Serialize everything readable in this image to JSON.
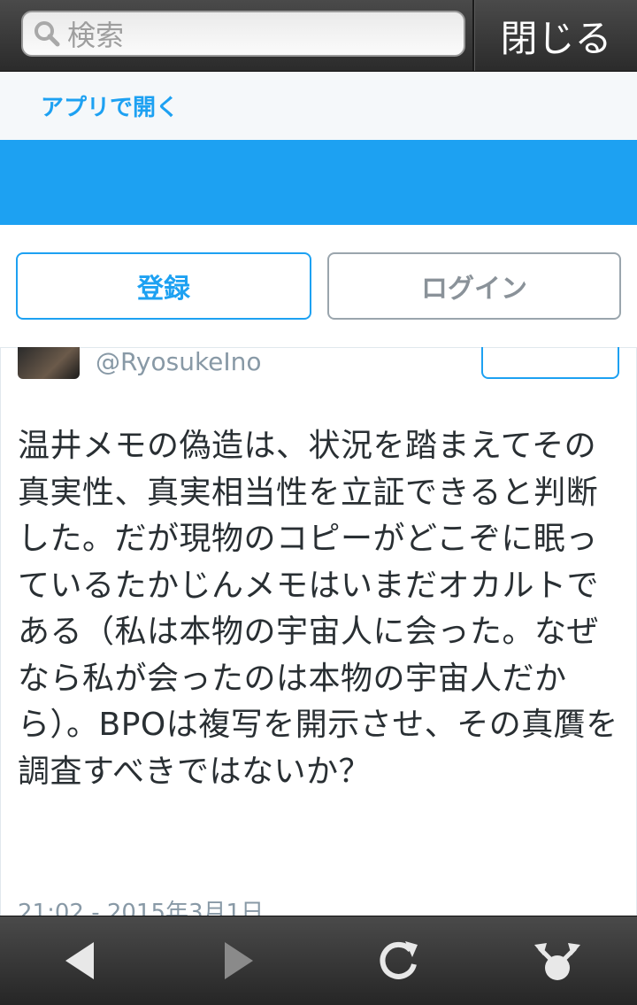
{
  "search": {
    "placeholder": "検索"
  },
  "header": {
    "close_label": "閉じる"
  },
  "open_app": {
    "label": "アプリで開く"
  },
  "auth": {
    "register_label": "登録",
    "login_label": "ログイン"
  },
  "tweet": {
    "handle": "@RyosukeIno",
    "text": "温井メモの偽造は、状況を踏まえてその真実性、真実相当性を立証できると判断した。だが現物のコピーがどこぞに眠っているたかじんメモはいまだオカルトである（私は本物の宇宙人に会った。なぜなら私が会ったのは本物の宇宙人だから）。BPOは複写を開示させ、その真贋を調査すべきではないか？",
    "timestamp": "21:02 - 2015年3月1日"
  },
  "toolbar": {
    "back_icon": "back-arrow-icon",
    "forward_icon": "forward-arrow-icon",
    "reload_icon": "reload-icon",
    "share_icon": "share-icon"
  },
  "colors": {
    "accent": "#1da1f2",
    "text": "#292f33",
    "muted": "#8899a6"
  }
}
